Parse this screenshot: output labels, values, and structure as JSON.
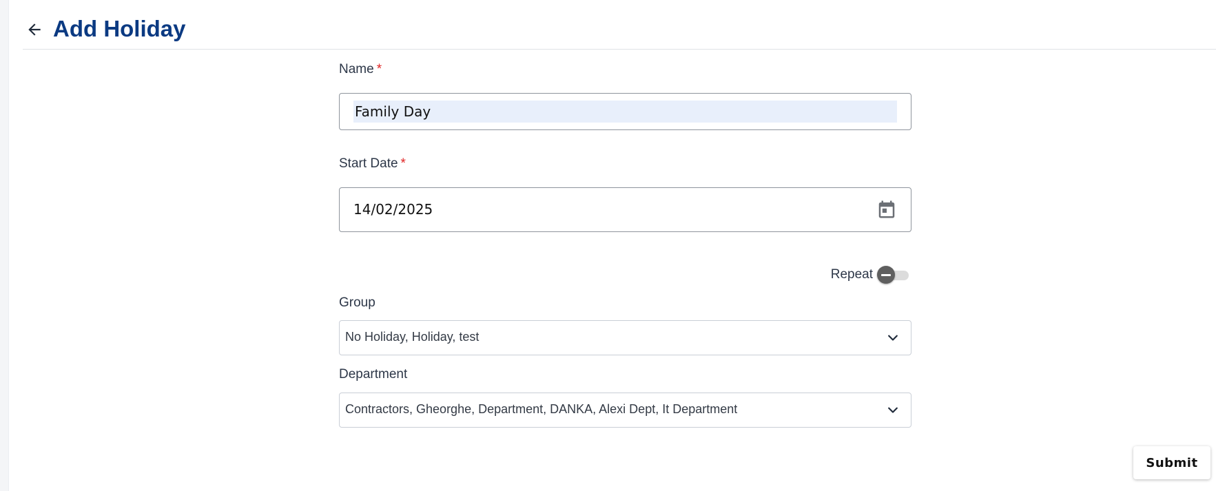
{
  "header": {
    "title": "Add Holiday",
    "back_icon": "arrow-left-icon"
  },
  "form": {
    "name": {
      "label": "Name",
      "required_mark": "*",
      "value": "Family Day"
    },
    "start_date": {
      "label": "Start Date",
      "required_mark": "*",
      "value": "14/02/2025",
      "icon": "calendar-icon"
    },
    "repeat": {
      "label": "Repeat",
      "enabled": false
    },
    "group": {
      "label": "Group",
      "selected": "No Holiday, Holiday, test",
      "icon": "chevron-down-icon"
    },
    "department": {
      "label": "Department",
      "selected": "Contractors, Gheorghe, Department, DANKA, Alexi Dept, It Department",
      "icon": "chevron-down-icon"
    }
  },
  "actions": {
    "submit_label": "Submit"
  },
  "colors": {
    "title": "#0b3a82",
    "required": "#e02424",
    "input_highlight": "#e8effb",
    "toggle_thumb": "#5f5f5f",
    "toggle_track": "#dcdcdc"
  }
}
